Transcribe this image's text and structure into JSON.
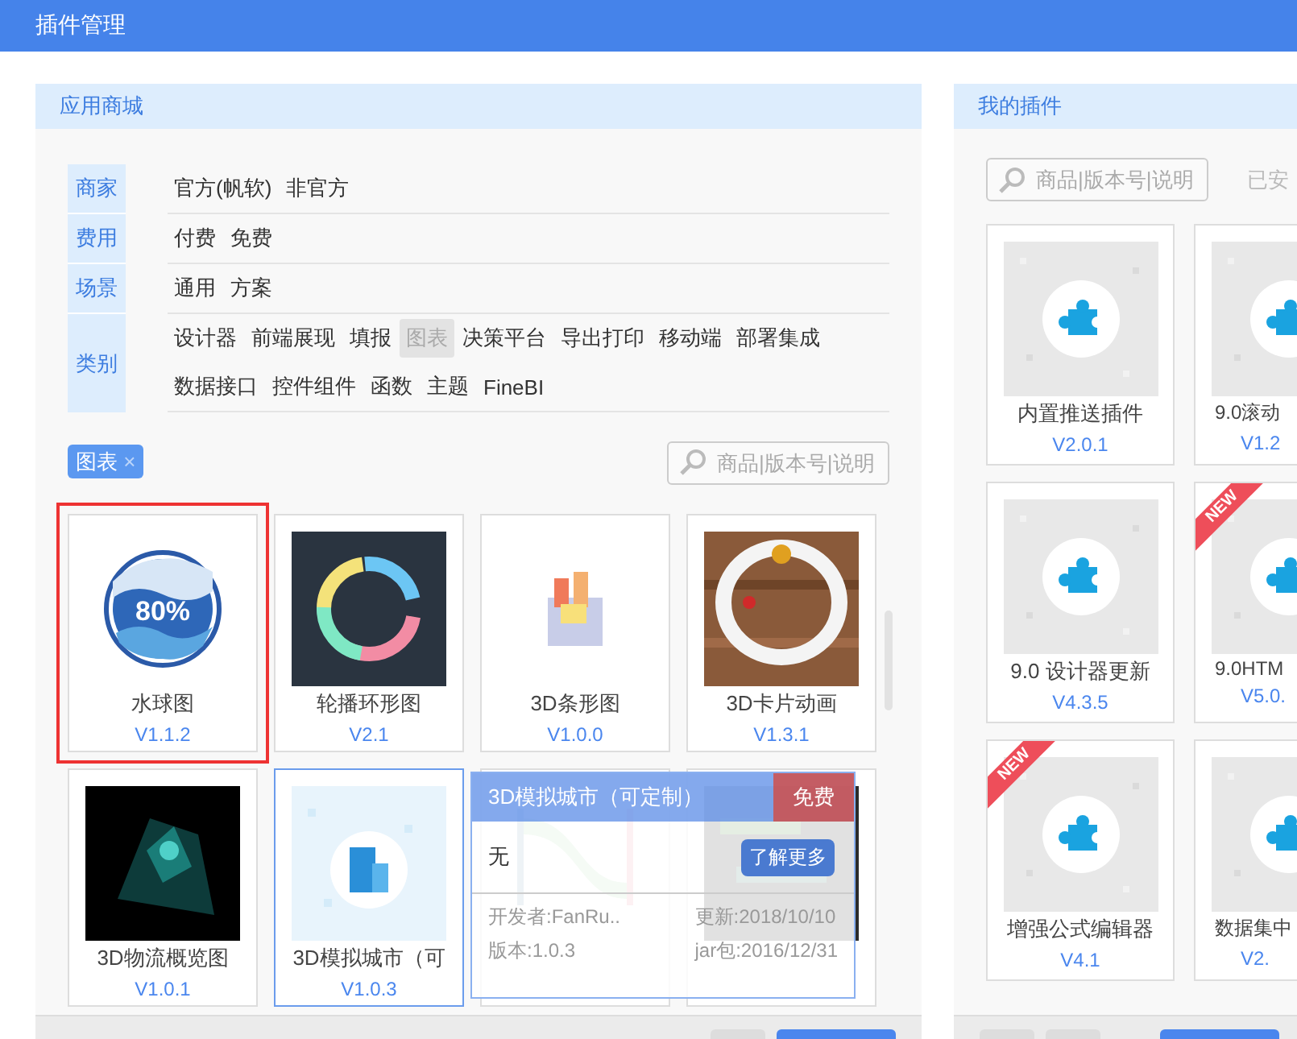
{
  "window": {
    "title": "插件管理"
  },
  "store": {
    "title": "应用商城",
    "filters": [
      {
        "label": "商家",
        "lines": [
          [
            {
              "text": "官方(帆软)",
              "selected": false
            },
            {
              "text": "非官方",
              "selected": false
            }
          ]
        ]
      },
      {
        "label": "费用",
        "lines": [
          [
            {
              "text": "付费",
              "selected": false
            },
            {
              "text": "免费",
              "selected": false
            }
          ]
        ]
      },
      {
        "label": "场景",
        "lines": [
          [
            {
              "text": "通用",
              "selected": false
            },
            {
              "text": "方案",
              "selected": false
            }
          ]
        ]
      },
      {
        "label": "类别",
        "lines": [
          [
            {
              "text": "设计器",
              "selected": false
            },
            {
              "text": "前端展现",
              "selected": false
            },
            {
              "text": "填报",
              "selected": false
            },
            {
              "text": "图表",
              "selected": true
            },
            {
              "text": "决策平台",
              "selected": false
            },
            {
              "text": "导出打印",
              "selected": false
            },
            {
              "text": "移动端",
              "selected": false
            },
            {
              "text": "部署集成",
              "selected": false
            }
          ],
          [
            {
              "text": "数据接口",
              "selected": false
            },
            {
              "text": "控件组件",
              "selected": false
            },
            {
              "text": "函数",
              "selected": false
            },
            {
              "text": "主题",
              "selected": false
            },
            {
              "text": "FineBI",
              "selected": false
            }
          ]
        ]
      }
    ],
    "chips": [
      {
        "text": "图表",
        "close": "×"
      }
    ],
    "search": {
      "placeholder": "商品|版本号|说明"
    },
    "cards": [
      {
        "name": "水球图",
        "version": "V1.1.2",
        "kind": "liquid",
        "thumb_text": "80%",
        "selected": true,
        "hovered": false
      },
      {
        "name": "轮播环形图",
        "version": "V2.1",
        "kind": "donut",
        "selected": false,
        "hovered": false
      },
      {
        "name": "3D条形图",
        "version": "V1.0.0",
        "kind": "bars",
        "selected": false,
        "hovered": false
      },
      {
        "name": "3D卡片动画",
        "version": "V1.3.1",
        "kind": "cards",
        "selected": false,
        "hovered": false
      },
      {
        "name": "3D物流概览图",
        "version": "V1.0.1",
        "kind": "particles",
        "selected": false,
        "hovered": false
      },
      {
        "name": "3D模拟城市（可",
        "version": "V1.0.3",
        "kind": "city",
        "selected": false,
        "hovered": true
      },
      {
        "kind": "sankey",
        "selected": false,
        "hovered": false
      },
      {
        "kind": "cloud",
        "selected": false,
        "hovered": false
      }
    ],
    "popup": {
      "title": "3D模拟城市（可定制）",
      "price": "免费",
      "description": "无",
      "button": "了解更多",
      "developer": "开发者:FanRu..",
      "updated": "更新:2018/10/10",
      "version": "版本:1.0.3",
      "jar": "jar包:2016/12/31"
    }
  },
  "mine": {
    "title": "我的插件",
    "search": {
      "placeholder": "商品|版本号|说明"
    },
    "installed_label": "已安",
    "cards": [
      {
        "name": "内置推送插件",
        "version": "V2.0.1"
      },
      {
        "name": "9.0滚动",
        "version": "V1.2"
      },
      {
        "name": "9.0 设计器更新",
        "version": "V4.3.5"
      },
      {
        "name": "9.0HTM",
        "version": "V5.0.",
        "ribbon": "NEW"
      },
      {
        "name": "增强公式编辑器",
        "version": "V4.1",
        "ribbon": "NEW"
      },
      {
        "name": "数据集中",
        "version": "V2."
      }
    ]
  }
}
